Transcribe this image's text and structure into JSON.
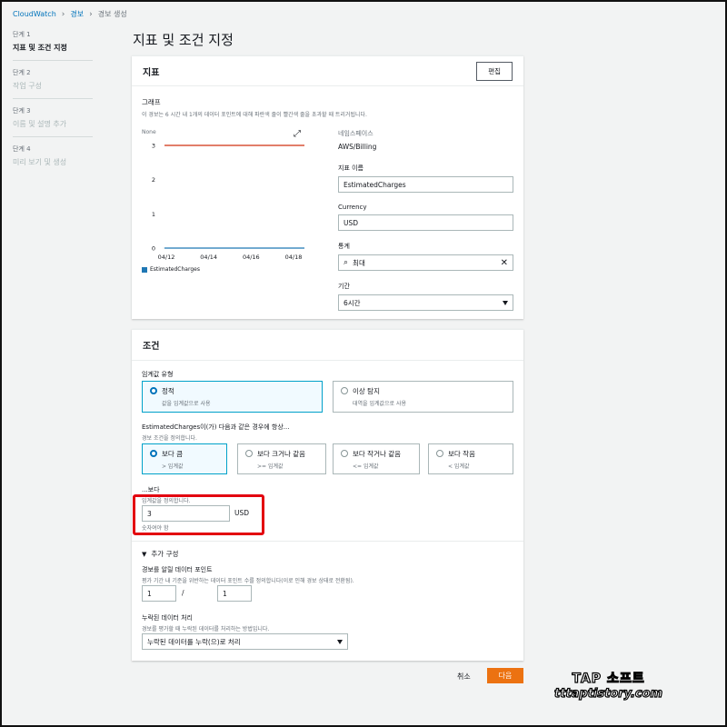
{
  "breadcrumb": {
    "root": "CloudWatch",
    "alarms": "경보",
    "current": "경보 생성"
  },
  "steps": [
    {
      "num": "단계 1",
      "label": "지표 및 조건 지정"
    },
    {
      "num": "단계 2",
      "label": "작업 구성"
    },
    {
      "num": "단계 3",
      "label": "이름 및 설명 추가"
    },
    {
      "num": "단계 4",
      "label": "미리 보기 및 생성"
    }
  ],
  "page_title": "지표 및 조건 지정",
  "metric_panel": {
    "title": "지표",
    "edit_label": "편집",
    "graph_title": "그래프",
    "graph_desc": "이 경보는 6 시간 내 1개의 데이터 포인트에 대해 파란색 줄이 빨간색 줄을 초과할 때 트리거됩니다.",
    "legend": "EstimatedCharges",
    "namespace_label": "네임스페이스",
    "namespace_value": "AWS/Billing",
    "metric_name_label": "지표 이름",
    "metric_name_value": "EstimatedCharges",
    "currency_label": "Currency",
    "currency_value": "USD",
    "stat_label": "통계",
    "stat_value": "최대",
    "period_label": "기간",
    "period_value": "6시간"
  },
  "chart_data": {
    "type": "line",
    "unit_label": "None",
    "x": [
      "04/12",
      "04/14",
      "04/16",
      "04/18"
    ],
    "ylim": [
      0,
      3
    ],
    "y_ticks": [
      0,
      1,
      2,
      3
    ],
    "series": [
      {
        "name": "threshold",
        "color": "#d13212",
        "values": [
          3,
          3,
          3,
          3
        ]
      },
      {
        "name": "EstimatedCharges",
        "color": "#1f77b4",
        "values": [
          0,
          0,
          0,
          0
        ]
      }
    ]
  },
  "conditions_panel": {
    "title": "조건",
    "threshold_type_label": "임계값 유형",
    "threshold_types": [
      {
        "title": "정적",
        "desc": "값을 임계값으로 사용",
        "selected": true
      },
      {
        "title": "이상 탐지",
        "desc": "대역을 임계값으로 사용",
        "selected": false
      }
    ],
    "whenever_label": "EstimatedCharges이(가) 다음과 같은 경우에 항상...",
    "whenever_desc": "경보 조건을 정의합니다.",
    "operators": [
      {
        "title": "보다 큼",
        "desc": "> 임계값",
        "selected": true
      },
      {
        "title": "보다 크거나 같음",
        "desc": ">= 임계값",
        "selected": false
      },
      {
        "title": "보다 작거나 같음",
        "desc": "<= 임계값",
        "selected": false
      },
      {
        "title": "보다 작음",
        "desc": "< 임계값",
        "selected": false
      }
    ],
    "than_label": "...보다",
    "than_desc": "임계값을 정의합니다.",
    "threshold_value": "3",
    "threshold_unit": "USD",
    "threshold_hint": "숫자여야 함",
    "additional_config": "추가 구성",
    "datapoints_label": "경보를 알릴 데이터 포인트",
    "datapoints_desc": "평가 기간 내 기준을 위반하는 데이터 포인트 수를 정의합니다(이로 인해 경보 상태로 전환됨).",
    "datapoints_value": "1",
    "datapoints_sep": "/",
    "evaluation_value": "1",
    "missing_label": "누락된 데이터 처리",
    "missing_desc": "경보를 평가할 때 누락된 데이터를 처리하는 방법입니다.",
    "missing_value": "누락된 데이터를 누락(으)로 처리"
  },
  "footer": {
    "cancel": "취소",
    "next": "다음"
  },
  "watermark": {
    "line1": "TAP 소프트",
    "line2": "tttaptistory.com"
  },
  "colors": {
    "accent": "#ec7211",
    "link": "#0073bb",
    "selected_border": "#00a1c9",
    "highlight": "#e3000f"
  }
}
